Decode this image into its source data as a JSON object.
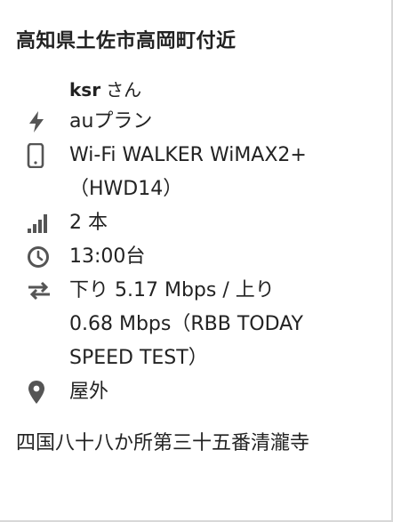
{
  "location_title": "高知県土佐市高岡町付近",
  "user": {
    "name": "ksr",
    "suffix": "さん"
  },
  "plan": {
    "icon": "bolt-icon",
    "text": "auプラン"
  },
  "device": {
    "icon": "phone-icon",
    "line1": "Wi-Fi WALKER WiMAX2+",
    "line2": "（HWD14）"
  },
  "signal": {
    "icon": "signal-bars-icon",
    "text": "2 本"
  },
  "time": {
    "icon": "clock-icon",
    "text": "13:00台"
  },
  "speed": {
    "icon": "transfer-arrows-icon",
    "line1": "下り 5.17 Mbps / 上り",
    "line2": "0.68 Mbps（RBB TODAY",
    "line3": "SPEED TEST）"
  },
  "place": {
    "icon": "map-pin-icon",
    "text": "屋外"
  },
  "comment": "四国八十八か所第三十五番清瀧寺",
  "colors": {
    "icon": "#555555",
    "text": "#222222",
    "border": "#d8d8d8"
  }
}
